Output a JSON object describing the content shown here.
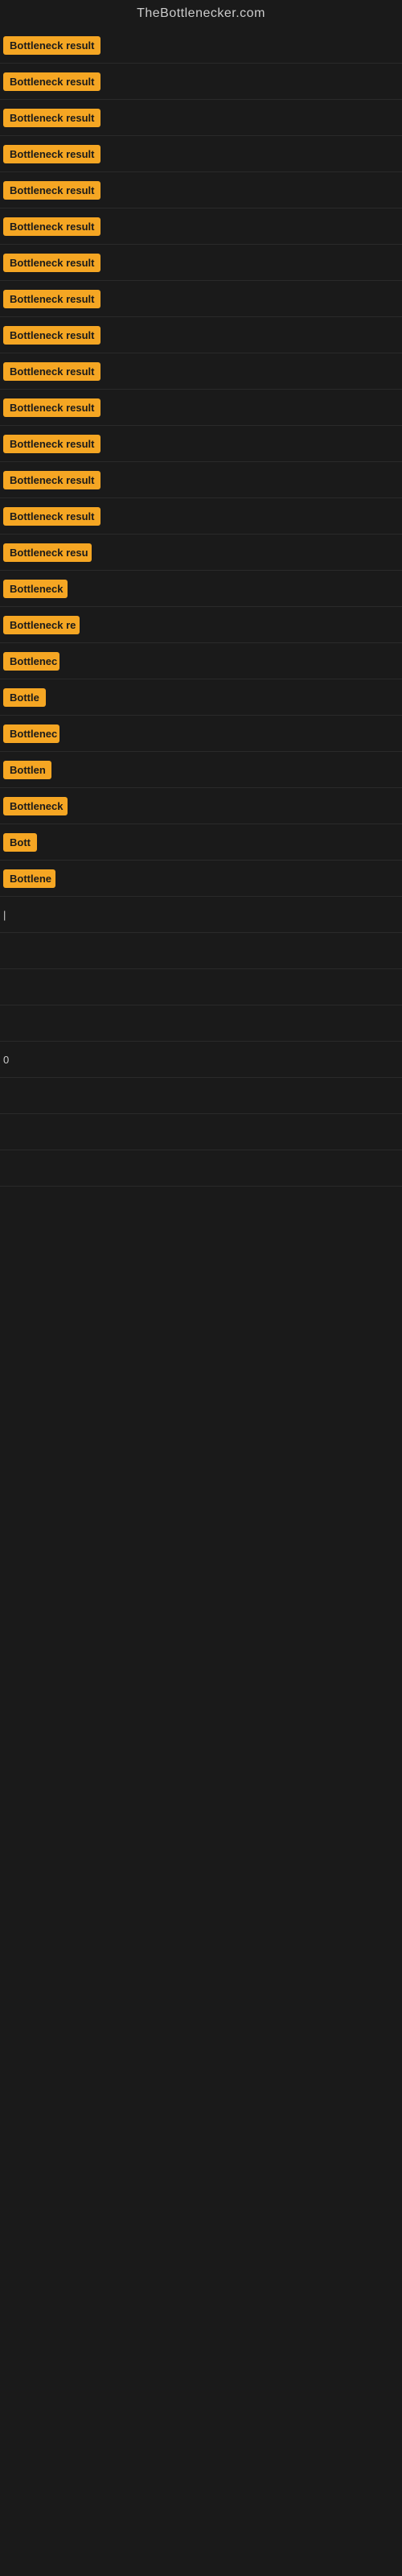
{
  "site": {
    "title": "TheBottlenecker.com"
  },
  "rows": [
    {
      "id": 1,
      "label": "Bottleneck result",
      "width": 130
    },
    {
      "id": 2,
      "label": "Bottleneck result",
      "width": 130
    },
    {
      "id": 3,
      "label": "Bottleneck result",
      "width": 130
    },
    {
      "id": 4,
      "label": "Bottleneck result",
      "width": 130
    },
    {
      "id": 5,
      "label": "Bottleneck result",
      "width": 130
    },
    {
      "id": 6,
      "label": "Bottleneck result",
      "width": 130
    },
    {
      "id": 7,
      "label": "Bottleneck result",
      "width": 130
    },
    {
      "id": 8,
      "label": "Bottleneck result",
      "width": 130
    },
    {
      "id": 9,
      "label": "Bottleneck result",
      "width": 130
    },
    {
      "id": 10,
      "label": "Bottleneck result",
      "width": 130
    },
    {
      "id": 11,
      "label": "Bottleneck result",
      "width": 130
    },
    {
      "id": 12,
      "label": "Bottleneck result",
      "width": 130
    },
    {
      "id": 13,
      "label": "Bottleneck result",
      "width": 130
    },
    {
      "id": 14,
      "label": "Bottleneck result",
      "width": 130
    },
    {
      "id": 15,
      "label": "Bottleneck resu",
      "width": 110
    },
    {
      "id": 16,
      "label": "Bottleneck",
      "width": 80
    },
    {
      "id": 17,
      "label": "Bottleneck re",
      "width": 95
    },
    {
      "id": 18,
      "label": "Bottlenec",
      "width": 70
    },
    {
      "id": 19,
      "label": "Bottle",
      "width": 55
    },
    {
      "id": 20,
      "label": "Bottlenec",
      "width": 70
    },
    {
      "id": 21,
      "label": "Bottlen",
      "width": 60
    },
    {
      "id": 22,
      "label": "Bottleneck",
      "width": 80
    },
    {
      "id": 23,
      "label": "Bott",
      "width": 42
    },
    {
      "id": 24,
      "label": "Bottlene",
      "width": 65
    },
    {
      "id": 25,
      "label": "|",
      "width": 10
    },
    {
      "id": 26,
      "label": "",
      "width": 0
    },
    {
      "id": 27,
      "label": "",
      "width": 0
    },
    {
      "id": 28,
      "label": "",
      "width": 0
    },
    {
      "id": 29,
      "label": "0",
      "width": 10
    },
    {
      "id": 30,
      "label": "",
      "width": 0
    },
    {
      "id": 31,
      "label": "",
      "width": 0
    },
    {
      "id": 32,
      "label": "",
      "width": 0
    }
  ]
}
